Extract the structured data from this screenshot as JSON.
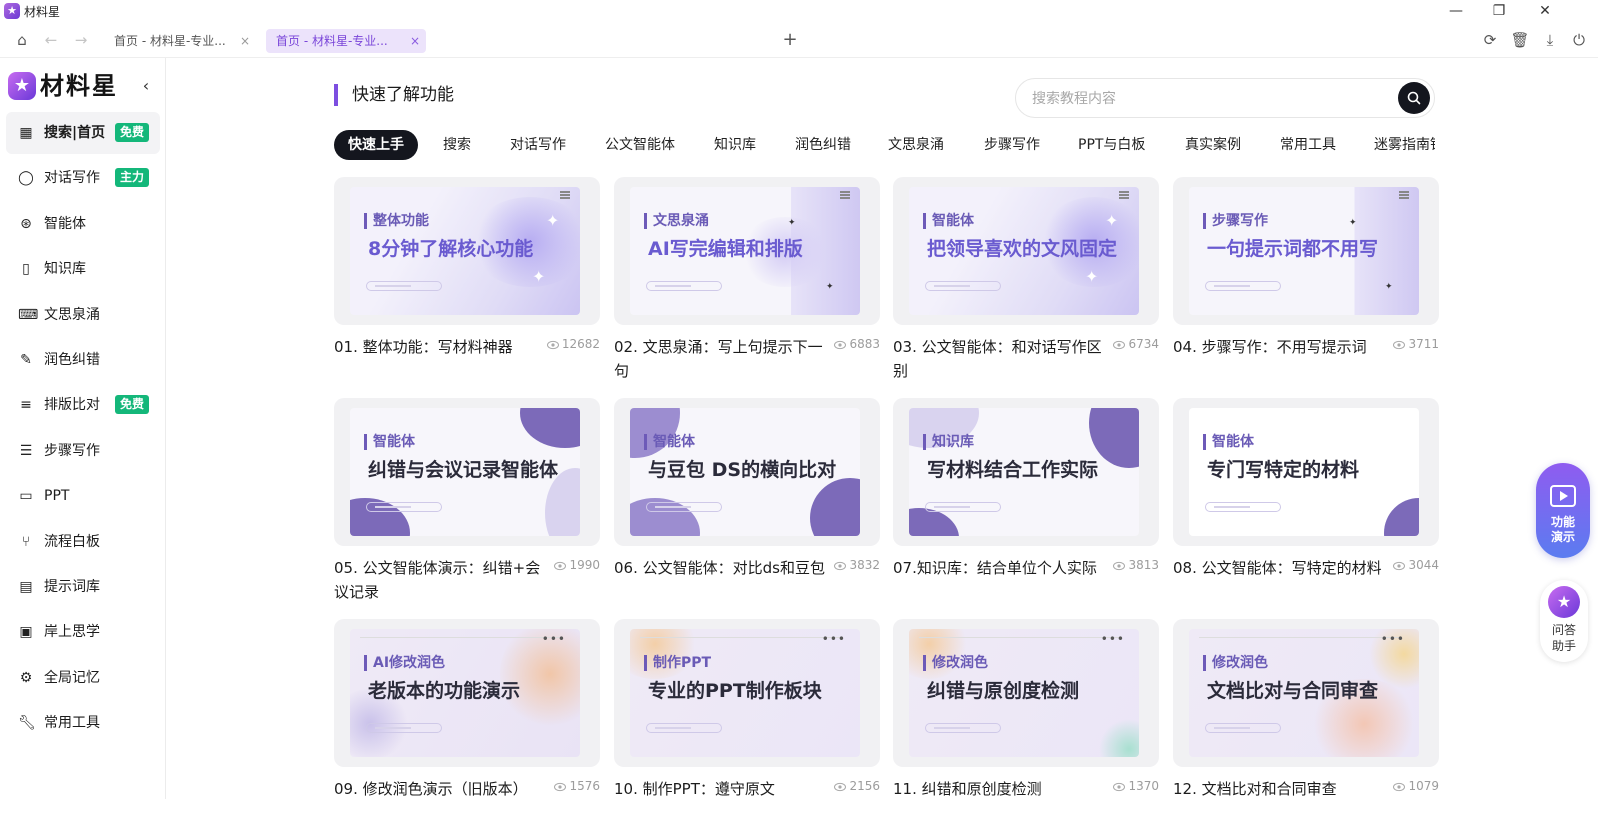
{
  "window": {
    "title": "材料星"
  },
  "tabs": [
    {
      "label": "首页 - 材料星-专业...",
      "close": "×"
    },
    {
      "label": "首页 - 材料星-专业...",
      "close": "×"
    }
  ],
  "toolbar": {
    "new_tab": "+"
  },
  "sidebar": {
    "brand": "材料星",
    "items": [
      {
        "label": "搜索|首页",
        "badge": "免费"
      },
      {
        "label": "对话写作",
        "badge": "主力"
      },
      {
        "label": "智能体"
      },
      {
        "label": "知识库"
      },
      {
        "label": "文思泉涌"
      },
      {
        "label": "润色纠错"
      },
      {
        "label": "排版比对",
        "badge": "免费"
      },
      {
        "label": "步骤写作"
      },
      {
        "label": "PPT"
      },
      {
        "label": "流程白板"
      },
      {
        "label": "提示词库"
      },
      {
        "label": "岸上思学"
      },
      {
        "label": "全局记忆"
      },
      {
        "label": "常用工具"
      }
    ]
  },
  "main": {
    "section_title": "快速了解功能",
    "search": {
      "placeholder": "搜索教程内容"
    },
    "categories": [
      "快速上手",
      "搜索",
      "对话写作",
      "公文智能体",
      "知识库",
      "润色纠错",
      "文思泉涌",
      "步骤写作",
      "PPT与白板",
      "真实案例",
      "常用工具",
      "迷雾指南针"
    ],
    "cards": [
      {
        "tag": "整体功能",
        "headline": "8分钟了解核心功能",
        "title": "01. 整体功能：写材料神器",
        "views": "12682"
      },
      {
        "tag": "文思泉涌",
        "headline": "AI写完编辑和排版",
        "title": "02. 文思泉涌：写上句提示下一句",
        "views": "6883"
      },
      {
        "tag": "智能体",
        "headline": "把领导喜欢的文风固定",
        "title": "03. 公文智能体：和对话写作区别",
        "views": "6734"
      },
      {
        "tag": "步骤写作",
        "headline": "一句提示词都不用写",
        "title": "04. 步骤写作：不用写提示词",
        "views": "3711"
      },
      {
        "tag": "智能体",
        "headline": "纠错与会议记录智能体",
        "title": "05. 公文智能体演示：纠错+会议记录",
        "views": "1990"
      },
      {
        "tag": "智能体",
        "headline": "与豆包 DS的横向比对",
        "title": "06. 公文智能体：对比ds和豆包",
        "views": "3832"
      },
      {
        "tag": "知识库",
        "headline": "写材料结合工作实际",
        "title": "07.知识库：结合单位个人实际",
        "views": "3813"
      },
      {
        "tag": "智能体",
        "headline": "专门写特定的材料",
        "title": "08. 公文智能体：写特定的材料",
        "views": "3044"
      },
      {
        "tag": "AI修改润色",
        "headline": "老版本的功能演示",
        "title": "09. 修改润色演示（旧版本）",
        "views": "1576"
      },
      {
        "tag": "制作PPT",
        "headline": "专业的PPT制作板块",
        "title": "10. 制作PPT：遵守原文",
        "views": "2156"
      },
      {
        "tag": "修改润色",
        "headline": "纠错与原创度检测",
        "title": "11. 纠错和原创度检测",
        "views": "1370"
      },
      {
        "tag": "修改润色",
        "headline": "文档比对与合同审查",
        "title": "12. 文档比对和合同审查",
        "views": "1079"
      }
    ]
  },
  "floating": {
    "demo": "功能演示",
    "help": "问答助手"
  },
  "colors": {
    "accent": "#7d4ee0",
    "badge": "#14b77a",
    "dark": "#14161e",
    "headline": "#2b2b3a",
    "headline_purple": "#6a5bd0"
  }
}
